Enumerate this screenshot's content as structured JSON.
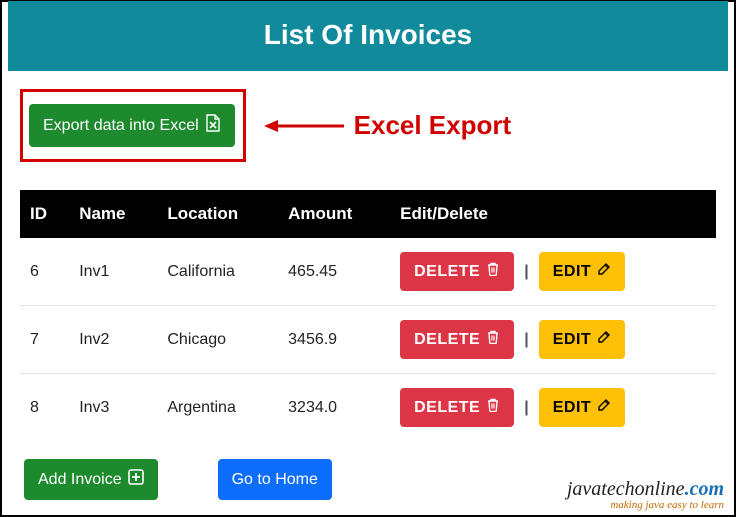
{
  "header": {
    "title": "List Of Invoices"
  },
  "export": {
    "button_label": "Export data into Excel",
    "callout_label": "Excel Export"
  },
  "table": {
    "headers": {
      "id": "ID",
      "name": "Name",
      "location": "Location",
      "amount": "Amount",
      "actions": "Edit/Delete"
    },
    "rows": [
      {
        "id": "6",
        "name": "Inv1",
        "location": "California",
        "amount": "465.45"
      },
      {
        "id": "7",
        "name": "Inv2",
        "location": "Chicago",
        "amount": "3456.9"
      },
      {
        "id": "8",
        "name": "Inv3",
        "location": "Argentina",
        "amount": "3234.0"
      }
    ],
    "actions": {
      "delete_label": "DELETE",
      "edit_label": "EDIT",
      "separator": "|"
    }
  },
  "footer": {
    "add_label": "Add Invoice",
    "home_label": "Go to Home"
  },
  "watermark": {
    "site": "javatechonline",
    "tld": ".com",
    "tagline": "making java easy to learn"
  }
}
